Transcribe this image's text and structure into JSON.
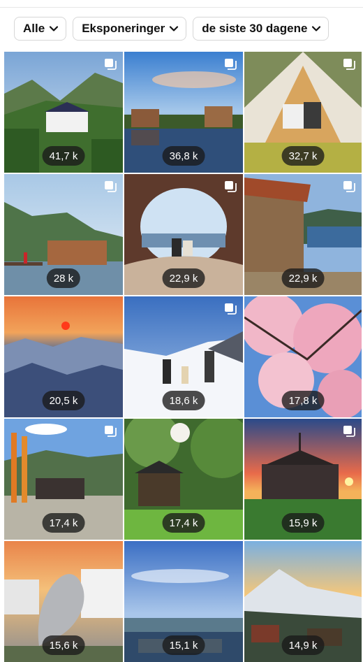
{
  "filters": {
    "type_label": "Alle",
    "metric_label": "Eksponeringer",
    "period_label": "de siste 30 dagene"
  },
  "icons": {
    "chevron": "chevron-down-icon",
    "multi": "carousel-multi-icon"
  },
  "posts": [
    {
      "impressions": "41,7 k",
      "multi": true
    },
    {
      "impressions": "36,8 k",
      "multi": true
    },
    {
      "impressions": "32,7 k",
      "multi": true
    },
    {
      "impressions": "28 k",
      "multi": true
    },
    {
      "impressions": "22,9 k",
      "multi": true
    },
    {
      "impressions": "22,9 k",
      "multi": true
    },
    {
      "impressions": "20,5 k",
      "multi": false
    },
    {
      "impressions": "18,6 k",
      "multi": true
    },
    {
      "impressions": "17,8 k",
      "multi": false
    },
    {
      "impressions": "17,4 k",
      "multi": true
    },
    {
      "impressions": "17,4 k",
      "multi": false
    },
    {
      "impressions": "15,9 k",
      "multi": true
    },
    {
      "impressions": "15,6 k",
      "multi": false
    },
    {
      "impressions": "15,1 k",
      "multi": false
    },
    {
      "impressions": "14,9 k",
      "multi": false
    }
  ]
}
